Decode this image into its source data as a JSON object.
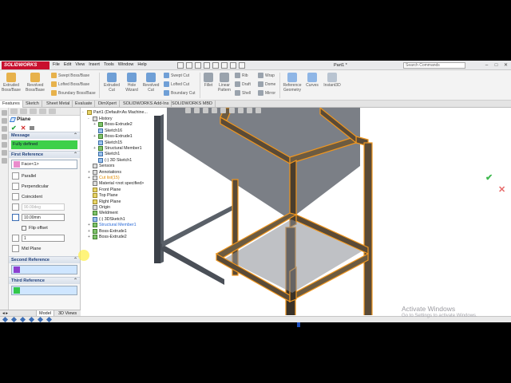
{
  "app": {
    "logo_text": "SOLIDWORKS",
    "document_title": "Part1 *",
    "search_placeholder": "Search Commands"
  },
  "menu": [
    "File",
    "Edit",
    "View",
    "Insert",
    "Tools",
    "Window",
    "Help"
  ],
  "ribbon": {
    "extruded_boss": "Extruded Boss/Base",
    "revolved_boss": "Revolved Boss/Base",
    "swept_boss": "Swept Boss/Base",
    "lofted_boss": "Lofted Boss/Base",
    "boundary_boss": "Boundary Boss/Base",
    "extruded_cut": "Extruded Cut",
    "hole_wizard": "Hole Wizard",
    "revolved_cut": "Revolved Cut",
    "swept_cut": "Swept Cut",
    "lofted_cut": "Lofted Cut",
    "boundary_cut": "Boundary Cut",
    "fillet": "Fillet",
    "linear_pattern": "Linear Pattern",
    "rib": "Rib",
    "draft": "Draft",
    "shell": "Shell",
    "wrap": "Wrap",
    "dome": "Dome",
    "mirror": "Mirror",
    "reference_geometry": "Reference Geometry",
    "curves": "Curves",
    "instant3d": "Instant3D"
  },
  "cm_tabs": [
    "Features",
    "Sketch",
    "Sheet Metal",
    "Evaluate",
    "DimXpert",
    "SOLIDWORKS Add-Ins",
    "SOLIDWORKS MBD"
  ],
  "property_manager": {
    "title": "Plane",
    "message_header": "Message",
    "message": "Fully defined",
    "first_reference_header": "First Reference",
    "first_reference_value": "Face<1>",
    "parallel": "Parallel",
    "perpendicular": "Perpendicular",
    "coincident": "Coincident",
    "angle_value": "90.00deg",
    "distance_value": "10.00mm",
    "flip_offset": "Flip offset",
    "instances_value": "1",
    "mid_plane": "Mid Plane",
    "second_reference_header": "Second Reference",
    "third_reference_header": "Third Reference"
  },
  "feature_tree": {
    "part_name": "Part1 (Default<As Machine...",
    "items": [
      {
        "label": "History",
        "indent": 1,
        "exp": "-"
      },
      {
        "label": "Boss-Extrude2",
        "indent": 2,
        "exp": "+"
      },
      {
        "label": "Sketch16",
        "indent": 2,
        "exp": ""
      },
      {
        "label": "Boss-Extrude1",
        "indent": 2,
        "exp": "+"
      },
      {
        "label": "Sketch15",
        "indent": 2,
        "exp": ""
      },
      {
        "label": "Structural Member1",
        "indent": 2,
        "exp": "+"
      },
      {
        "label": "Sketch1",
        "indent": 2,
        "exp": ""
      },
      {
        "label": "(-) 3D Sketch1",
        "indent": 2,
        "exp": ""
      },
      {
        "label": "Sensors",
        "indent": 1,
        "exp": ""
      },
      {
        "label": "Annotations",
        "indent": 1,
        "exp": "+"
      },
      {
        "label": "Cut list(15)",
        "indent": 1,
        "exp": "+"
      },
      {
        "label": "Material <not specified>",
        "indent": 1,
        "exp": ""
      },
      {
        "label": "Front Plane",
        "indent": 1,
        "exp": ""
      },
      {
        "label": "Top Plane",
        "indent": 1,
        "exp": ""
      },
      {
        "label": "Right Plane",
        "indent": 1,
        "exp": ""
      },
      {
        "label": "Origin",
        "indent": 1,
        "exp": ""
      },
      {
        "label": "Weldment",
        "indent": 1,
        "exp": ""
      },
      {
        "label": "(-) 3DSketch1",
        "indent": 1,
        "exp": ""
      },
      {
        "label": "Structural Member1",
        "indent": 1,
        "exp": "+"
      },
      {
        "label": "Boss-Extrude1",
        "indent": 1,
        "exp": "+"
      },
      {
        "label": "Boss-Extrude2",
        "indent": 1,
        "exp": "+"
      }
    ]
  },
  "bottom_tabs": [
    "Model",
    "3D Views"
  ],
  "watermark": {
    "line1": "Activate Windows",
    "line2": "Go to Settings to activate Windows."
  },
  "colors": {
    "accent_orange": "#f0961e",
    "message_green": "#3ed04a",
    "frame_dark": "#3b4048",
    "face_gray": "#7b7f86"
  }
}
